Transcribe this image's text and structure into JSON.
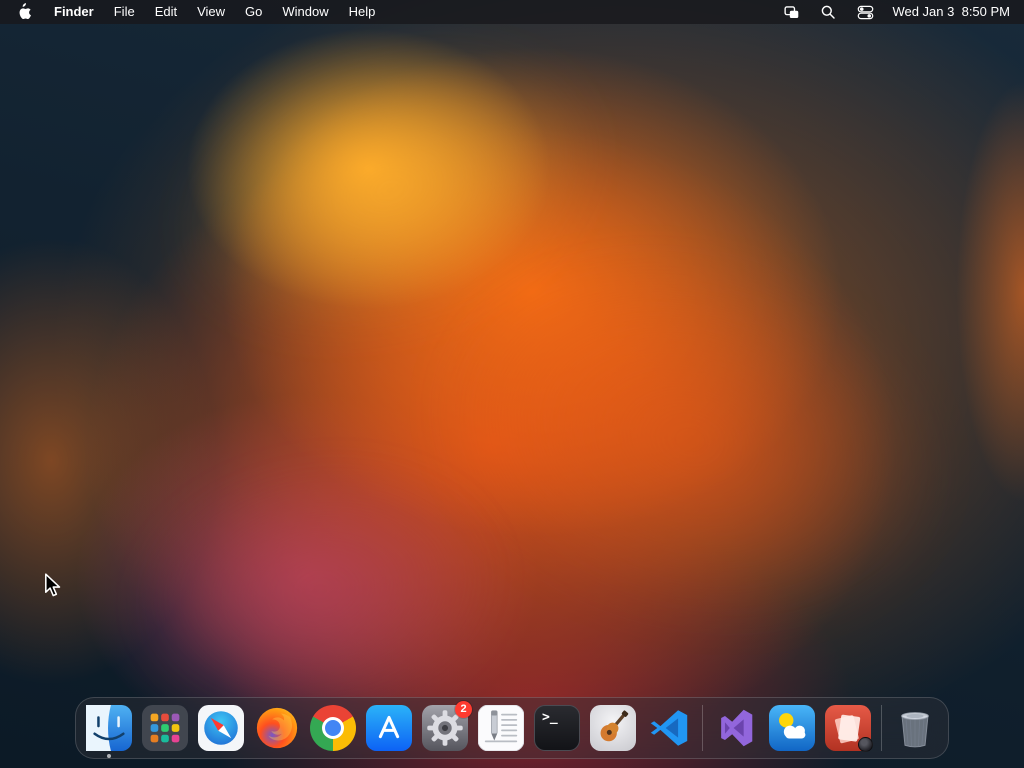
{
  "menubar": {
    "app_name": "Finder",
    "menus": [
      "File",
      "Edit",
      "View",
      "Go",
      "Window",
      "Help"
    ],
    "status_icons": [
      "screen-mirroring",
      "search",
      "control-center"
    ],
    "clock": "Wed Jan 3  8:50 PM"
  },
  "dock": {
    "items": [
      {
        "label": "Finder",
        "running": true
      },
      {
        "label": "Launchpad"
      },
      {
        "label": "Safari"
      },
      {
        "label": "Firefox"
      },
      {
        "label": "Google Chrome"
      },
      {
        "label": "App Store"
      },
      {
        "label": "System Settings",
        "badge": "2"
      },
      {
        "label": "TextEdit"
      },
      {
        "label": "Terminal"
      },
      {
        "label": "GarageBand"
      },
      {
        "label": "Visual Studio Code"
      },
      {
        "label": "Visual Studio"
      },
      {
        "label": "Weather"
      },
      {
        "label": "Photo Booth"
      },
      {
        "label": "Trash"
      }
    ],
    "glyphs": {
      "terminal": ">_"
    },
    "badge_color": "#ff3b30"
  }
}
